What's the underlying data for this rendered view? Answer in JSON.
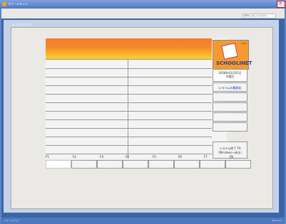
{
  "window": {
    "title": "スクールネット",
    "close_glyph": "×"
  },
  "toolbar": {
    "help_placeholder": "質問を入力してください"
  },
  "workspace": {
    "caption": "メインメニュー"
  },
  "logo": {
    "version": "4.4.1",
    "text": "SCHOOLINET"
  },
  "date": {
    "line1": "2008年03月05日",
    "line2": "水曜日"
  },
  "side": {
    "update_label": "システムの最適化"
  },
  "exit": {
    "line1": "システム終了 F9",
    "line2": "（Windowsへ戻る）"
  },
  "function_keys": [
    "F1",
    "F2",
    "F3",
    "F4",
    "F5",
    "F6",
    "F7",
    "F8"
  ],
  "status": {
    "left": "フォーム ビュー",
    "right": "NumLock"
  },
  "colors": {
    "header_top": "#f37a2b",
    "header_bottom": "#f9d02b",
    "titlebar": "#4f79bf"
  }
}
